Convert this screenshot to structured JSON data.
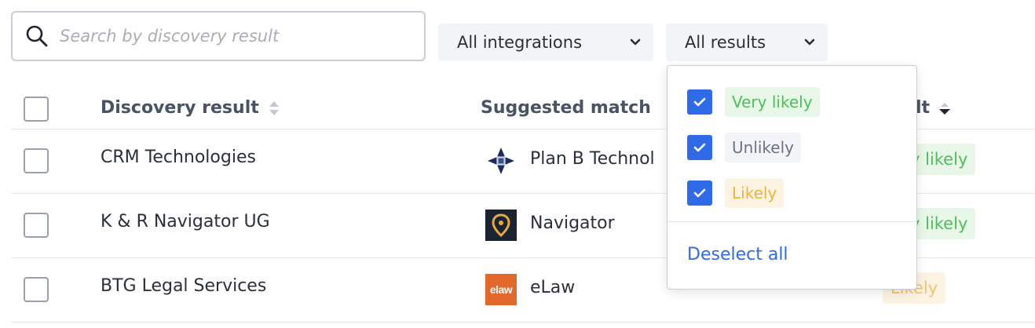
{
  "search": {
    "placeholder": "Search by discovery result",
    "value": ""
  },
  "filters": {
    "integrations": {
      "label": "All integrations"
    },
    "results": {
      "label": "All results"
    }
  },
  "table": {
    "headers": {
      "discovery": "Discovery result",
      "match": "Suggested match",
      "result_fragment": "lt"
    },
    "rows": [
      {
        "discovery": "CRM Technologies",
        "match": "Plan B Technol",
        "logo": "plan-b-logo",
        "result_fragment": "y likely",
        "result_color": "#4cc05a"
      },
      {
        "discovery": "K & R Navigator UG",
        "match": "Navigator",
        "logo": "navigator-logo",
        "result_fragment": "y likely",
        "result_color": "#4cc05a"
      },
      {
        "discovery": "BTG Legal Services",
        "match": "eLaw",
        "logo": "elaw-logo",
        "logo_text": "elaw",
        "result_fragment": "Likely",
        "result_color": "#f4c36a"
      }
    ]
  },
  "dropdown": {
    "options": [
      {
        "label": "Very likely",
        "checked": true,
        "color": "#4cc05a"
      },
      {
        "label": "Unlikely",
        "checked": true,
        "color": "#6b7387"
      },
      {
        "label": "Likely",
        "checked": true,
        "color": "#f0b23e"
      }
    ],
    "deselect_label": "Deselect all"
  },
  "colors": {
    "accent": "#2f6be6",
    "border": "#c9ced6",
    "filter_bg": "#f2f4f7"
  }
}
